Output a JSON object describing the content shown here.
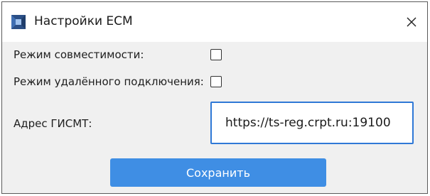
{
  "window": {
    "title": "Настройки ECM",
    "icon": "ecm-app-icon",
    "close_icon": "close-icon"
  },
  "form": {
    "compat_mode_label": "Режим совместимости:",
    "compat_mode_checked": false,
    "remote_mode_label": "Режим удалённого подключения:",
    "remote_mode_checked": false,
    "address_label": "Адрес ГИСМТ:",
    "address_value": "https://ts-reg.crpt.ru:19100"
  },
  "actions": {
    "save_label": "Сохранить"
  },
  "colors": {
    "accent": "#3f8ee4",
    "input_border": "#2f78d6",
    "window_bg": "#f0f0f0"
  }
}
